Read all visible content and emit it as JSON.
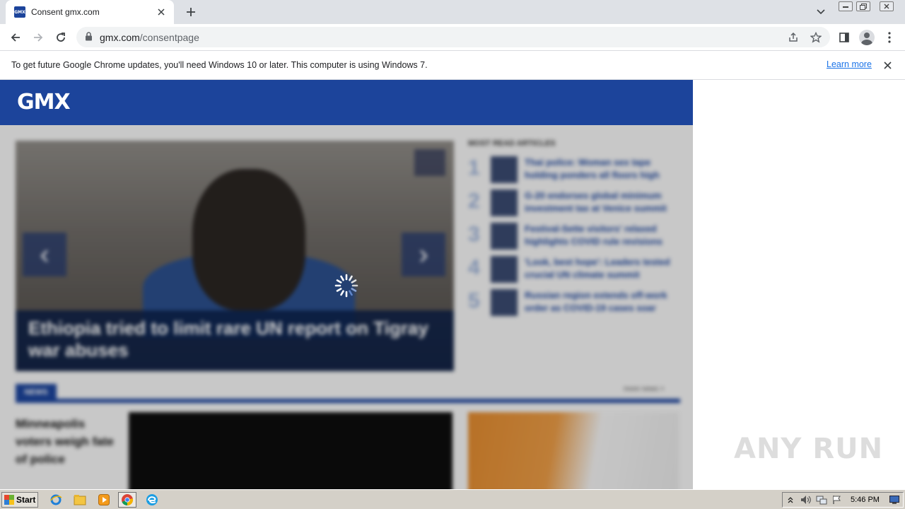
{
  "browser": {
    "tab": {
      "title": "Consent gmx.com",
      "favicon_text": "GMX"
    },
    "address": {
      "host": "gmx.com",
      "path": "/consentpage"
    }
  },
  "infobar": {
    "message": "To get future Google Chrome updates, you'll need Windows 10 or later. This computer is using Windows 7.",
    "learn_more": "Learn more"
  },
  "site": {
    "logo": "GMX",
    "hero": {
      "title": "Ethiopia tried to limit rare UN report on Tigray war abuses"
    },
    "most_read": {
      "heading": "MOST READ ARTICLES",
      "items": [
        {
          "num": "1",
          "text": "Thai police: Woman sex tape holding ponders all floors high"
        },
        {
          "num": "2",
          "text": "G-20 endorses global minimum investment tax at Venice summit"
        },
        {
          "num": "3",
          "text": "Festival-Sette visitors' relaxed highlights COVID rule revisions"
        },
        {
          "num": "4",
          "text": "'Look, best hope': Leaders tested crucial UN climate summit"
        },
        {
          "num": "5",
          "text": "Russian region extends off-work order as COVID-19 cases soar"
        }
      ]
    },
    "section": {
      "tab": "NEWS",
      "more": "more news >"
    },
    "story_left": "Minneapolis voters weigh fate of police"
  },
  "watermark": "ANY RUN",
  "taskbar": {
    "start": "Start",
    "clock": "5:46 PM"
  },
  "colors": {
    "gmx_blue": "#1c449b",
    "link": "#1a73e8"
  }
}
